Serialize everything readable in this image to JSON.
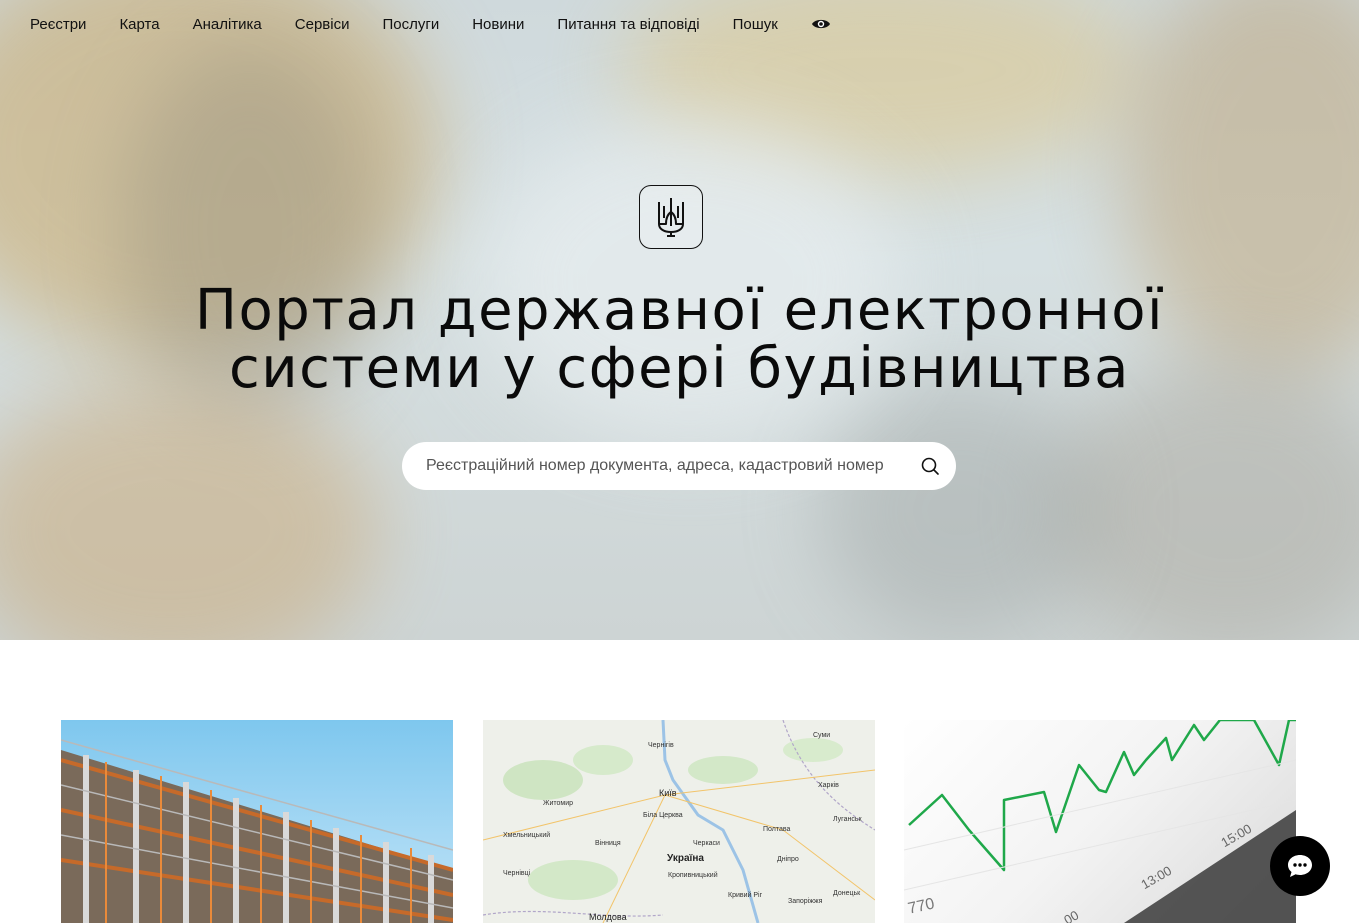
{
  "nav": {
    "items": [
      "Реєстри",
      "Карта",
      "Аналітика",
      "Сервіси",
      "Послуги",
      "Новини",
      "Питання та відповіді",
      "Пошук"
    ],
    "accessibility_icon": "eye-icon"
  },
  "hero": {
    "emblem_icon": "trident-icon",
    "title_line1": "Портал державної електронної",
    "title_line2": "системи у сфері будівництва"
  },
  "search": {
    "placeholder": "Реєстраційний номер документа, адреса, кадастровий номер",
    "icon": "search-icon"
  },
  "cards": {
    "map_labels": [
      "Чернігів",
      "Житомир",
      "Київ",
      "Полтава",
      "Україна",
      "Дніпро",
      "Кривий Ріг",
      "Запоріжжя",
      "Донецьк",
      "Молдова",
      "Суми",
      "Харків",
      "Черкаси",
      "Вінниця",
      "Кропивницький",
      "Біла Церква",
      "Луганськ",
      "Хмельницький",
      "Чернівці"
    ],
    "chart_ticks": [
      "770",
      "13:00",
      "15:00",
      "00"
    ]
  },
  "chat": {
    "icon": "chat-bubble-icon"
  },
  "colors": {
    "chart_line": "#1fa84a",
    "chat_bg": "#000000",
    "search_bg": "#ffffff"
  }
}
